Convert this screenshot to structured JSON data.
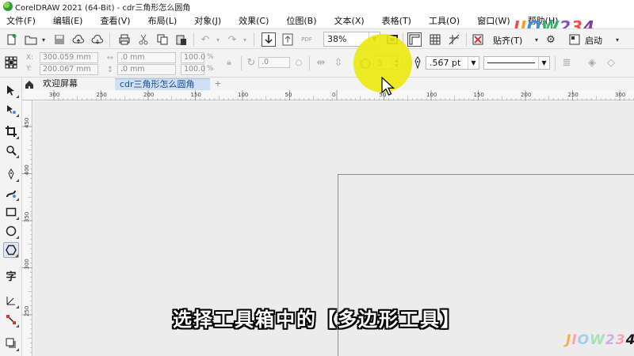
{
  "window": {
    "title": "CorelDRAW 2021 (64-Bit) - cdr三角形怎么圆角"
  },
  "menu": [
    "文件(F)",
    "编辑(E)",
    "查看(V)",
    "布局(L)",
    "对象(J)",
    "效果(C)",
    "位图(B)",
    "文本(X)",
    "表格(T)",
    "工具(O)",
    "窗口(W)",
    "帮助(H)"
  ],
  "brand": {
    "logo_text": "JIOW234",
    "chars": [
      "J",
      "I",
      "O",
      "W",
      "2",
      "3",
      "4"
    ]
  },
  "toolbar": {
    "zoom_value": "38%",
    "snap_label": "贴齐(T)",
    "launch_label": "启动",
    "pdf_label": "PDF"
  },
  "propbar": {
    "x_label": "X:",
    "x_value": "300.059 mm",
    "y_label": "Y:",
    "y_value": "200.067 mm",
    "w_value": ".0 mm",
    "h_value": ".0 mm",
    "scale_x": "100.0",
    "scale_y": "100.0",
    "percent_x": "%",
    "percent_y": "%",
    "angle_value": ".0",
    "sides_value": "5",
    "outline_width": ".567 pt"
  },
  "tabs": {
    "welcome": "欢迎屏幕",
    "document": "cdr三角形怎么圆角",
    "add": "+"
  },
  "ruler": {
    "h_ticks": [
      "300",
      "250",
      "200",
      "150",
      "100",
      "50",
      "0",
      "50",
      "100",
      "150",
      "200",
      "250",
      "300"
    ],
    "v_ticks": [
      "450",
      "400",
      "350",
      "300",
      "250"
    ]
  },
  "subtitle": "选择工具箱中的【多边形工具】",
  "colors": {
    "highlight": "#ece814",
    "active_tab": "#cfe0f5",
    "canvas": "#ececec"
  }
}
